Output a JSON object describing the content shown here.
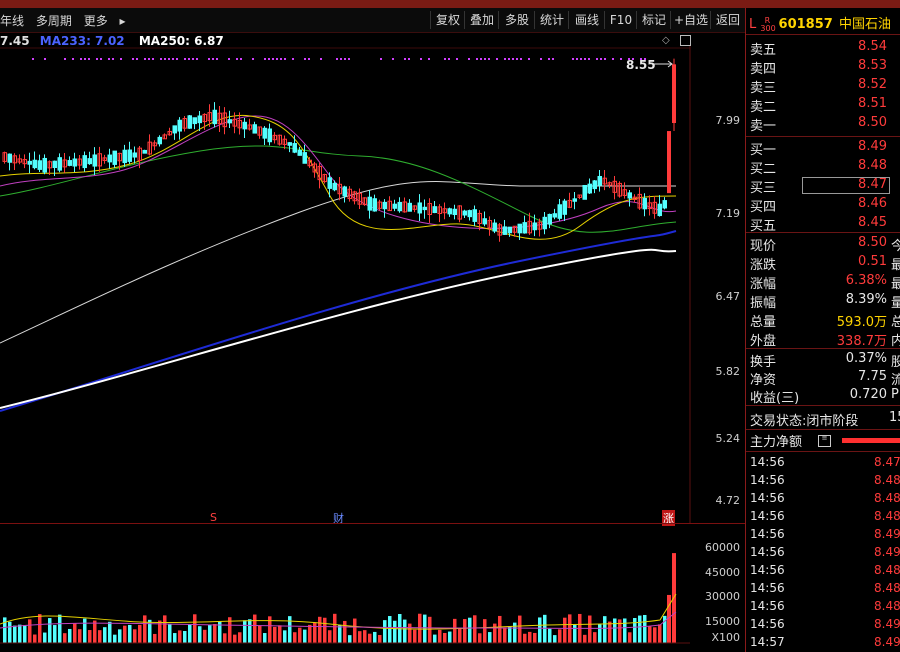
{
  "toolbar": {
    "left": [
      "年线",
      "多周期",
      "更多"
    ],
    "buttons": [
      "复权",
      "叠加",
      "多股",
      "统计",
      "画线",
      "F10",
      "标记",
      "+自选",
      "返回"
    ]
  },
  "ma": {
    "ma1": "7.45",
    "ma233": "MA233: 7.02",
    "ma250": "MA250: 6.87"
  },
  "chart": {
    "price_axis": [
      "7.99",
      "7.19",
      "6.47",
      "5.82",
      "5.24",
      "4.72"
    ],
    "high_label": "8.55",
    "markers": [
      "S",
      "财",
      "涨"
    ],
    "volume_axis": [
      "60000",
      "45000",
      "30000",
      "15000"
    ],
    "volume_unit": "X100"
  },
  "stock": {
    "market_l": "L",
    "market_r": "R",
    "market_sub": "300",
    "code": "601857",
    "name": "中国石油"
  },
  "asks": [
    {
      "label": "卖五",
      "price": "8.54"
    },
    {
      "label": "卖四",
      "price": "8.53"
    },
    {
      "label": "卖三",
      "price": "8.52"
    },
    {
      "label": "卖二",
      "price": "8.51"
    },
    {
      "label": "卖一",
      "price": "8.50"
    }
  ],
  "bids": [
    {
      "label": "买一",
      "price": "8.49"
    },
    {
      "label": "买二",
      "price": "8.48"
    },
    {
      "label": "买三",
      "price": "8.47"
    },
    {
      "label": "买四",
      "price": "8.46"
    },
    {
      "label": "买五",
      "price": "8.45"
    }
  ],
  "quote": [
    {
      "label": "现价",
      "value": "8.50",
      "extra": "今",
      "color": "#ff3b3b"
    },
    {
      "label": "涨跌",
      "value": "0.51",
      "extra": "最",
      "color": "#ff3b3b"
    },
    {
      "label": "涨幅",
      "value": "6.38%",
      "extra": "最",
      "color": "#ff3b3b"
    },
    {
      "label": "振幅",
      "value": "8.39%",
      "extra": "量",
      "color": "#e6e6e6"
    },
    {
      "label": "总量",
      "value": "593.0万",
      "extra": "总",
      "color": "#ffd400"
    },
    {
      "label": "外盘",
      "value": "338.7万",
      "extra": "内",
      "color": "#ff3b3b"
    }
  ],
  "quote2": [
    {
      "label": "换手",
      "value": "0.37%",
      "extra": "股",
      "color": "#e6e6e6"
    },
    {
      "label": "净资",
      "value": "7.75",
      "extra": "流",
      "color": "#e6e6e6"
    },
    {
      "label": "收益(三)",
      "value": "0.720",
      "extra": "PE",
      "color": "#e6e6e6"
    }
  ],
  "status": {
    "label": "交易状态:",
    "value": "闭市阶段",
    "extra": "15"
  },
  "mainflow": {
    "label": "主力净额"
  },
  "ticks": [
    {
      "time": "14:56",
      "price": "8.47"
    },
    {
      "time": "14:56",
      "price": "8.48"
    },
    {
      "time": "14:56",
      "price": "8.48"
    },
    {
      "time": "14:56",
      "price": "8.48"
    },
    {
      "time": "14:56",
      "price": "8.49"
    },
    {
      "time": "14:56",
      "price": "8.49"
    },
    {
      "time": "14:56",
      "price": "8.48"
    },
    {
      "time": "14:56",
      "price": "8.48"
    },
    {
      "time": "14:56",
      "price": "8.48"
    },
    {
      "time": "14:56",
      "price": "8.49"
    },
    {
      "time": "14:57",
      "price": "8.49"
    }
  ],
  "colors": {
    "up": "#ff3b3b",
    "down": "#54ffff",
    "ma233": "#1e2bd6",
    "ma250": "#ffffff",
    "panel_border": "#8a1a1a"
  }
}
